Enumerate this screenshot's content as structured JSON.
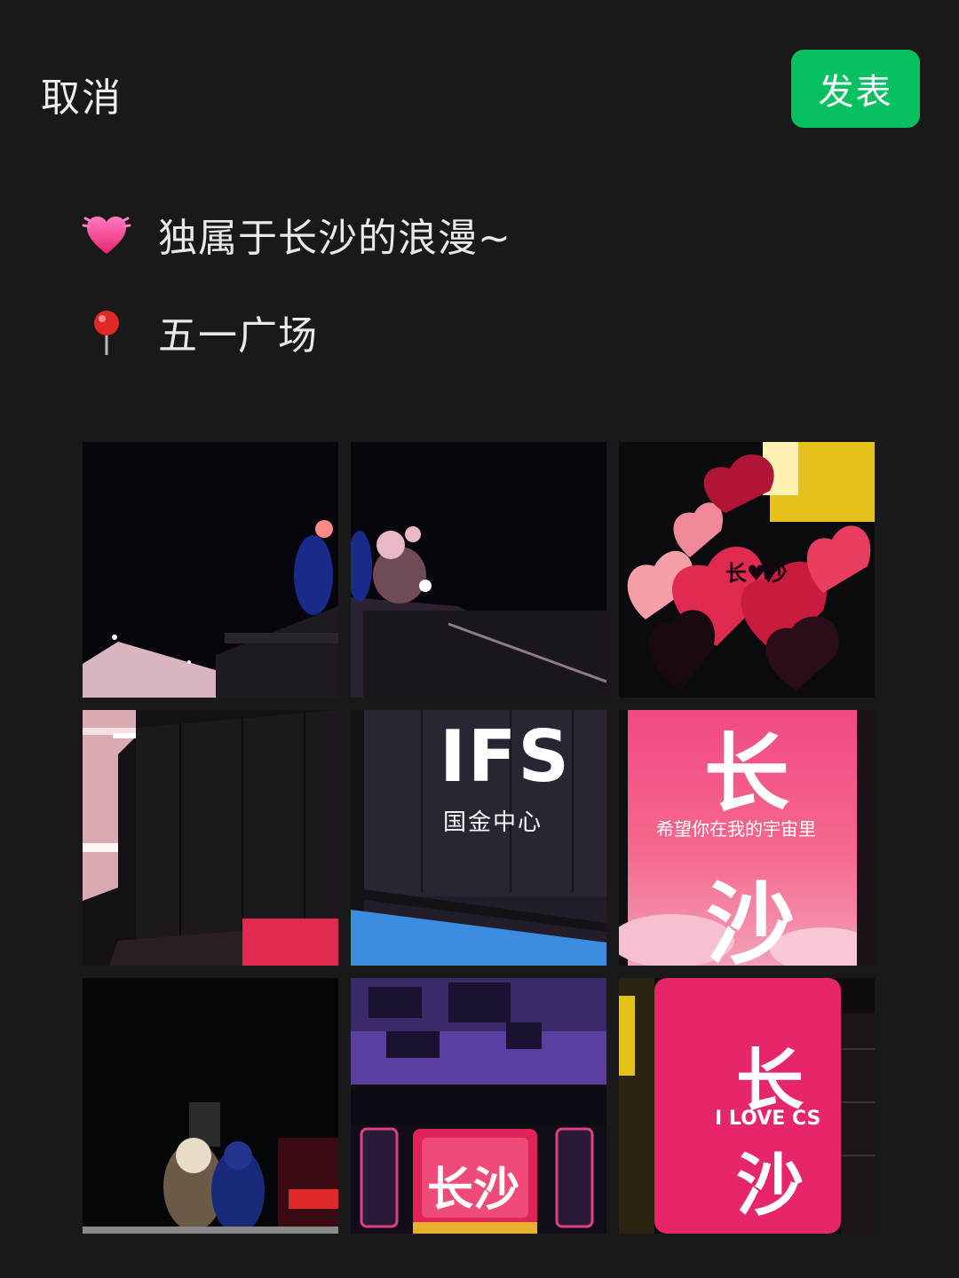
{
  "header": {
    "cancel_label": "取消",
    "publish_label": "发表",
    "publish_color": "#07c160"
  },
  "post": {
    "caption_icon": "sparkling-heart-icon",
    "caption": "独属于长沙的浪漫~",
    "location_icon": "location-pin-icon",
    "location": "五一广场"
  },
  "photos": {
    "ifs_label": "IFS",
    "ifs_sub": "国金中心",
    "screen1_big_top": "长",
    "screen1_line": "希望你在我的宇宙里",
    "screen1_big_bottom": "沙",
    "balloon_text": "长♥沙",
    "sign_text": "长沙",
    "screen2_top": "长",
    "screen2_line": "I LOVE CS",
    "screen2_bottom": "沙"
  }
}
